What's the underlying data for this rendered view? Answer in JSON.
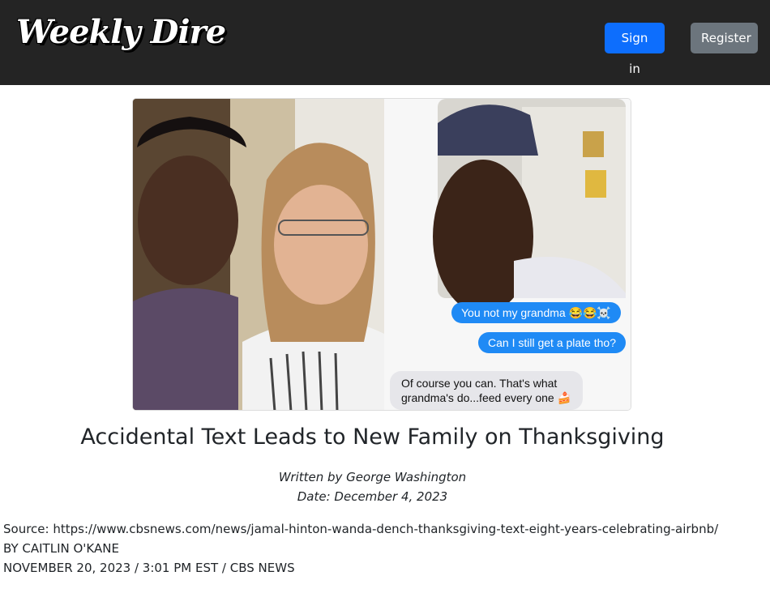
{
  "header": {
    "brand": "Weekly Dire",
    "signin_label": "Sign in",
    "register_label": "Register"
  },
  "hero": {
    "messages": [
      {
        "from": "sender",
        "text": "You not my grandma 😂😂☠️"
      },
      {
        "from": "sender",
        "text": "Can I still get a plate tho?"
      },
      {
        "from": "receiver",
        "text": "Of course you can.  That's what\ngrandma's do...feed every one 🍰"
      }
    ]
  },
  "article": {
    "title": "Accidental Text Leads to New Family on Thanksgiving",
    "author": "Written by George Washington",
    "date": "Date: December 4, 2023",
    "source": "Source: https://www.cbsnews.com/news/jamal-hinton-wanda-dench-thanksgiving-text-eight-years-celebrating-airbnb/",
    "byline": "BY CAITLIN O'KANE",
    "timestamp": "NOVEMBER 20, 2023 / 3:01 PM EST / CBS NEWS"
  },
  "colors": {
    "header_bg": "#242424",
    "signin_bg": "#0d6efd",
    "register_bg": "#6c757d",
    "imessage_blue": "#1f8af5",
    "imessage_gray": "#e6e6ea"
  }
}
